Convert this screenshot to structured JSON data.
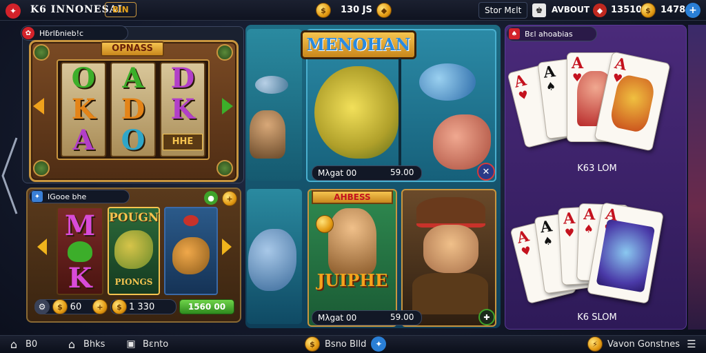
{
  "header": {
    "brand_text": "K6 INNONESAI",
    "tag": "BIN",
    "balance": "130 JS",
    "promo_label": "Stor Mɛlt",
    "user_label": "AVBOUT",
    "gem_count": "13510",
    "coin_count": "1478"
  },
  "slot_panel": {
    "title": "Hɓrlɓnieb!c",
    "banner": "OPNASS",
    "reel1": [
      "O",
      "K",
      "A"
    ],
    "reel2": [
      "A",
      "D",
      "O"
    ],
    "reel3": [
      "D",
      "K",
      "HHE"
    ]
  },
  "mini_slot": {
    "title": "IGooe bhe",
    "reel1": [
      "M",
      "K"
    ],
    "reel2_top": "POUGN",
    "reel2_bottom": "PIONGS",
    "bet": "60 60",
    "total": "1 330",
    "win": "1560 00"
  },
  "fish_game": {
    "title": "MENOHAN",
    "stat_left": "Mλgat 00",
    "stat_right": "59.00"
  },
  "hero_game": {
    "banner": "AHBESS",
    "title": "JUIPHE",
    "stat_left": "Mλgat 00",
    "stat_right": "59.00"
  },
  "poker_panel": {
    "title": "Bɛl ahoabias",
    "top_label": "K63 LOM",
    "bottom_label": "K6 SLOM"
  },
  "bottom_nav": {
    "item1": "B0",
    "item2": "Bhks",
    "item3": "Bɛnto",
    "center": "Bsno Blld",
    "right": "Vavon Gonstnes"
  },
  "colors": {
    "gold": "#e6a21c",
    "teal_water": "#1a6f8a",
    "green_button": "#3fa32a",
    "purple_bg": "#3a2468"
  }
}
